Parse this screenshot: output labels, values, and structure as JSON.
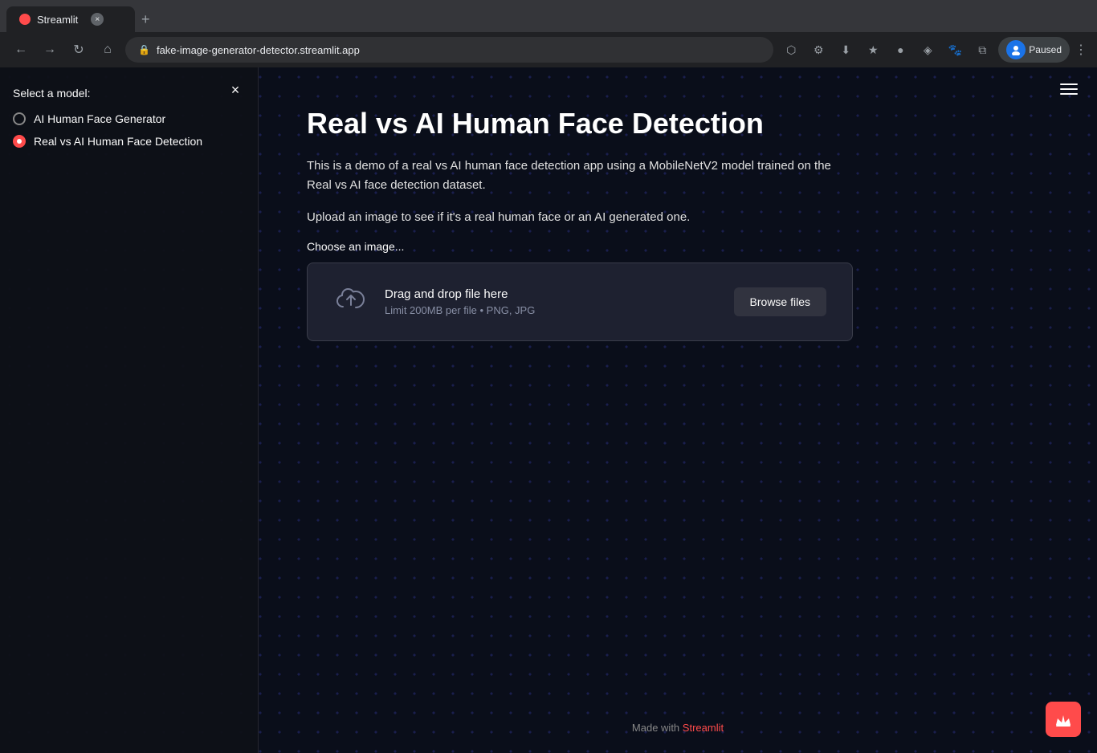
{
  "browser": {
    "tab_title": "Streamlit",
    "url": "fake-image-generator-detector.streamlit.app",
    "new_tab_label": "+",
    "back_label": "←",
    "forward_label": "→",
    "refresh_label": "↻",
    "home_label": "⌂",
    "paused_label": "Paused",
    "menu_label": "⋮"
  },
  "sidebar": {
    "close_label": "×",
    "model_select_label": "Select a model:",
    "options": [
      {
        "id": "ai-human-face-generator",
        "label": "AI Human Face Generator",
        "checked": false
      },
      {
        "id": "real-vs-ai-detection",
        "label": "Real vs AI Human Face Detection",
        "checked": true
      }
    ]
  },
  "main": {
    "page_title": "Real vs AI Human Face Detection",
    "description1": "This is a demo of a real vs AI human face detection app using a MobileNetV2 model trained on the Real vs AI face detection dataset.",
    "description2": "Upload an image to see if it's a real human face or an AI generated one.",
    "upload_label": "Choose an image...",
    "upload_drag_text": "Drag and drop file here",
    "upload_limit_text": "Limit 200MB per file • PNG, JPG",
    "browse_button_label": "Browse files"
  },
  "footer": {
    "text": "Made with ",
    "link_text": "Streamlit"
  }
}
